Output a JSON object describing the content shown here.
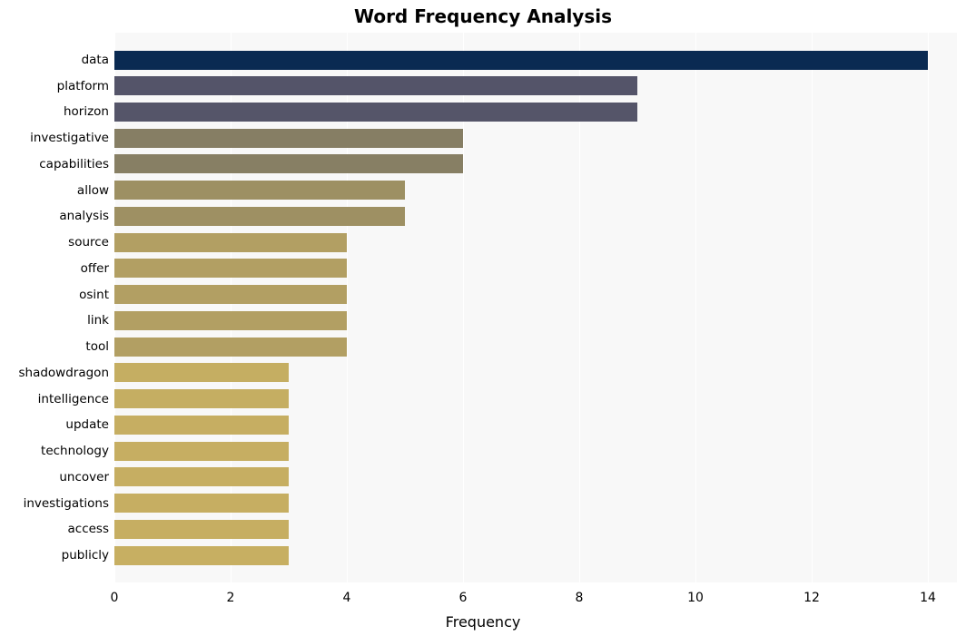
{
  "chart_data": {
    "type": "bar",
    "orientation": "horizontal",
    "title": "Word Frequency Analysis",
    "xlabel": "Frequency",
    "ylabel": "",
    "xlim": [
      0,
      14.5
    ],
    "xticks": [
      0,
      2,
      4,
      6,
      8,
      10,
      12,
      14
    ],
    "categories": [
      "data",
      "platform",
      "horizon",
      "investigative",
      "capabilities",
      "allow",
      "analysis",
      "source",
      "offer",
      "osint",
      "link",
      "tool",
      "shadowdragon",
      "intelligence",
      "update",
      "technology",
      "uncover",
      "investigations",
      "access",
      "publicly"
    ],
    "values": [
      14,
      9,
      9,
      6,
      6,
      5,
      5,
      4,
      4,
      4,
      4,
      4,
      3,
      3,
      3,
      3,
      3,
      3,
      3,
      3
    ],
    "colors": [
      "#0a2a52",
      "#545469",
      "#555569",
      "#867e64",
      "#877f64",
      "#9d9063",
      "#9e9063",
      "#b29f63",
      "#b29f63",
      "#b29f63",
      "#b29f63",
      "#b29f63",
      "#c5ae62",
      "#c5ae62",
      "#c6ae62",
      "#c6ae62",
      "#c6ae62",
      "#c6ae62",
      "#c6ae62",
      "#c7af62"
    ]
  }
}
